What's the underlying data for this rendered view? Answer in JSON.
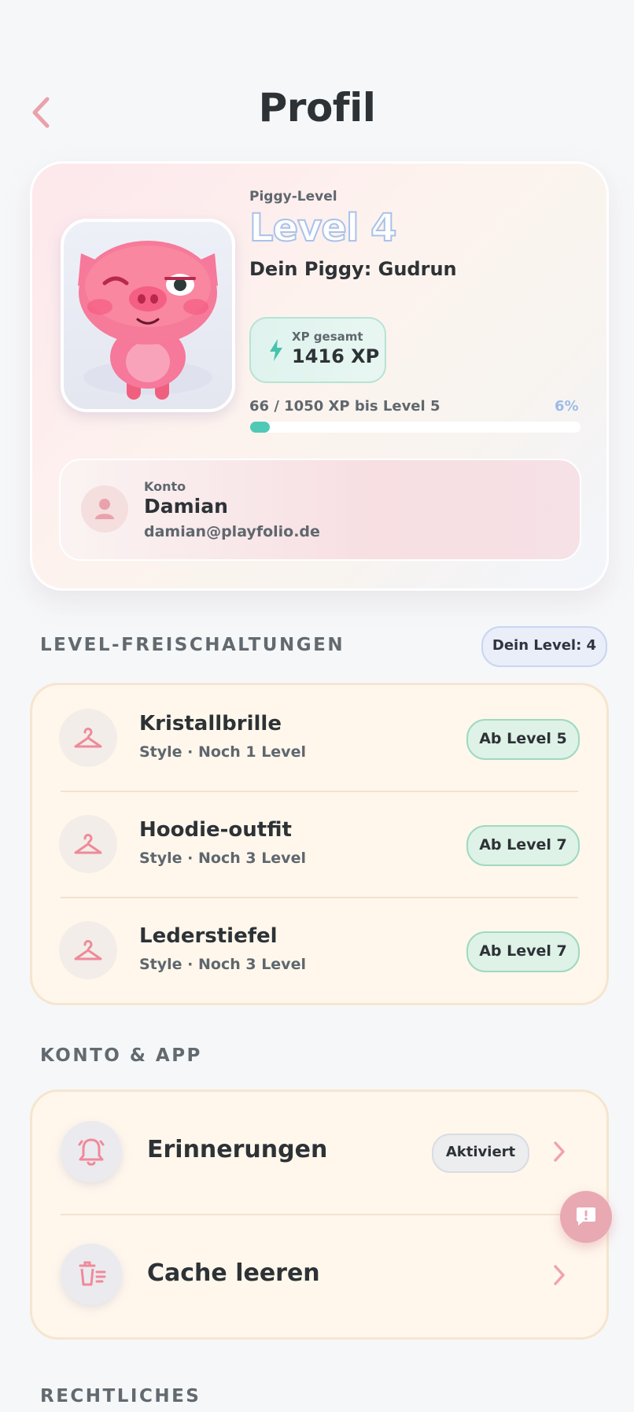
{
  "header": {
    "title": "Profil",
    "back_icon": "chevron-left-icon"
  },
  "profile": {
    "level_caption": "Piggy-Level",
    "level_value": "Level 4",
    "piggy_name_line": "Dein Piggy: Gudrun",
    "xp_label": "XP gesamt",
    "xp_value": "1416 XP",
    "progress_text": "66 / 1050 XP bis Level 5",
    "progress_percent_label": "6%",
    "progress_fraction": 0.06,
    "account": {
      "caption": "Konto",
      "name": "Damian",
      "email": "damian@playfolio.de"
    }
  },
  "unlocks": {
    "title": "LEVEL-FREISCHALTUNGEN",
    "your_level_badge": "Dein Level: 4",
    "items": [
      {
        "name": "Kristallbrille",
        "sub": "Style · Noch 1 Level",
        "badge": "Ab Level 5",
        "icon": "hanger-icon"
      },
      {
        "name": "Hoodie-outfit",
        "sub": "Style · Noch 3 Level",
        "badge": "Ab Level 7",
        "icon": "hanger-icon"
      },
      {
        "name": "Lederstiefel",
        "sub": "Style · Noch 3 Level",
        "badge": "Ab Level 7",
        "icon": "hanger-icon"
      }
    ]
  },
  "account_app": {
    "title": "KONTO & APP",
    "items": [
      {
        "label": "Erinnerungen",
        "status": "Aktiviert",
        "icon": "bell-icon"
      },
      {
        "label": "Cache leeren",
        "icon": "trash-icon"
      }
    ]
  },
  "legal": {
    "title": "RECHTLICHES"
  },
  "colors": {
    "accent_pink": "#e8a9b3",
    "accent_teal": "#4fc9b6",
    "level_blue": "#a9c2ea"
  }
}
